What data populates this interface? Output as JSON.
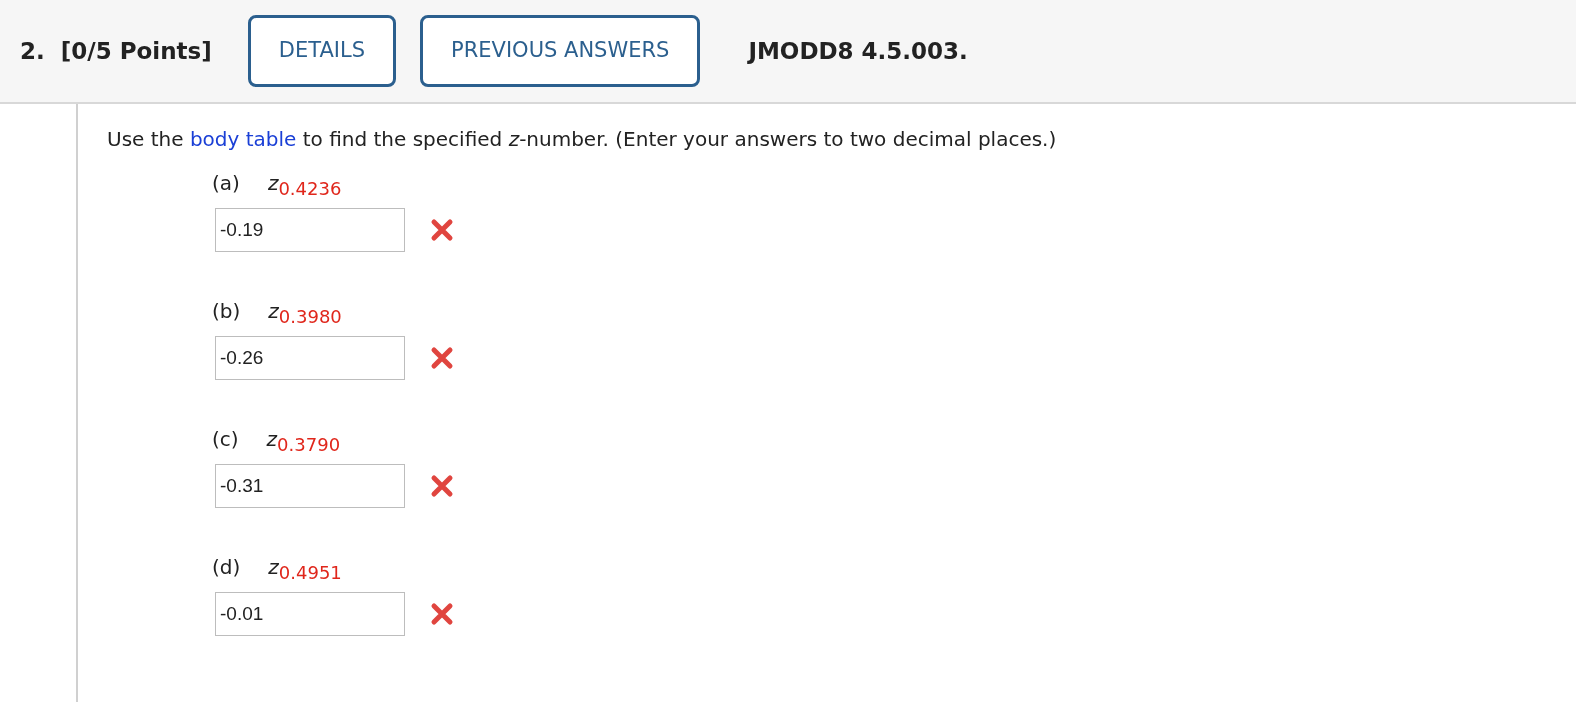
{
  "question": {
    "number": "2.",
    "points": "[0/5 Points]",
    "buttons": [
      "DETAILS",
      "PREVIOUS ANSWERS"
    ],
    "code": "JMODD8 4.5.003."
  },
  "prompt": {
    "before": "Use the",
    "link": "body table",
    "after": "to find the specified *z*-number. (Enter your answers to two decimal places.)"
  },
  "parts": [
    {
      "label": "(a)",
      "variable": "z",
      "subscript": "0.4236",
      "answer": "-0.19",
      "correct": false
    },
    {
      "label": "(b)",
      "variable": "z",
      "subscript": "0.3980",
      "answer": "-0.26",
      "correct": false
    },
    {
      "label": "(c)",
      "variable": "z",
      "subscript": "0.3790",
      "answer": "-0.31",
      "correct": false
    },
    {
      "label": "(d)",
      "variable": "z",
      "subscript": "0.4951",
      "answer": "-0.01",
      "correct": false
    }
  ]
}
